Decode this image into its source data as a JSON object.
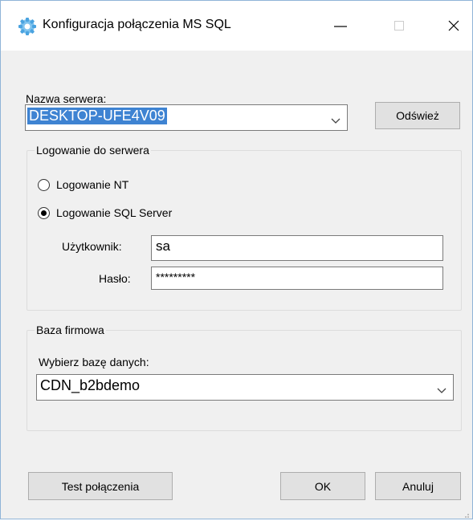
{
  "window": {
    "title": "Konfiguracja połączenia MS SQL"
  },
  "server": {
    "label": "Nazwa serwera:",
    "value": "DESKTOP-UFE4V09",
    "refresh_button": "Odśwież"
  },
  "login_group": {
    "legend": "Logowanie do serwera",
    "radio_nt": "Logowanie NT",
    "radio_sql": "Logowanie SQL Server",
    "selected": "Logowanie SQL Server",
    "user_label": "Użytkownik:",
    "user_value": "sa",
    "password_label": "Hasło:",
    "password_value": "*********"
  },
  "database_group": {
    "legend": "Baza firmowa",
    "label": "Wybierz bazę danych:",
    "value": "CDN_b2bdemo"
  },
  "footer": {
    "test_button": "Test połączenia",
    "ok_button": "OK",
    "cancel_button": "Anuluj"
  },
  "icons": {
    "app": "gear-icon",
    "minimize": "minimize-icon",
    "maximize": "maximize-icon",
    "close": "close-icon",
    "dropdown": "chevron-down-icon"
  }
}
